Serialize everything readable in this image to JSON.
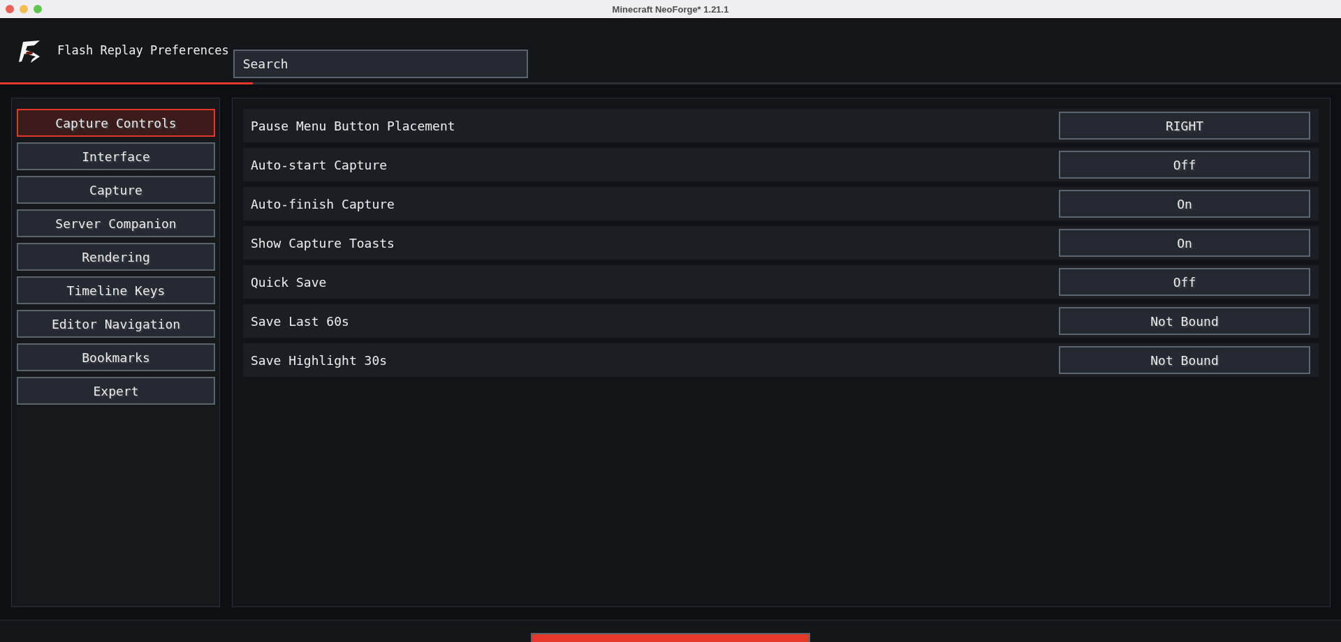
{
  "window": {
    "title": "Minecraft NeoForge* 1.21.1"
  },
  "header": {
    "title": "Flash Replay Preferences",
    "search": {
      "placeholder": "Search"
    }
  },
  "sidebar": {
    "items": [
      {
        "label": "Capture Controls",
        "selected": true
      },
      {
        "label": "Interface",
        "selected": false
      },
      {
        "label": "Capture",
        "selected": false
      },
      {
        "label": "Server Companion",
        "selected": false
      },
      {
        "label": "Rendering",
        "selected": false
      },
      {
        "label": "Timeline Keys",
        "selected": false
      },
      {
        "label": "Editor Navigation",
        "selected": false
      },
      {
        "label": "Bookmarks",
        "selected": false
      },
      {
        "label": "Expert",
        "selected": false
      }
    ]
  },
  "settings": [
    {
      "label": "Pause Menu Button Placement",
      "value": "RIGHT"
    },
    {
      "label": "Auto-start Capture",
      "value": "Off"
    },
    {
      "label": "Auto-finish Capture",
      "value": "On"
    },
    {
      "label": "Show Capture Toasts",
      "value": "On"
    },
    {
      "label": "Quick Save",
      "value": "Off"
    },
    {
      "label": "Save Last 60s",
      "value": "Not Bound"
    },
    {
      "label": "Save Highlight 30s",
      "value": "Not Bound"
    }
  ]
}
